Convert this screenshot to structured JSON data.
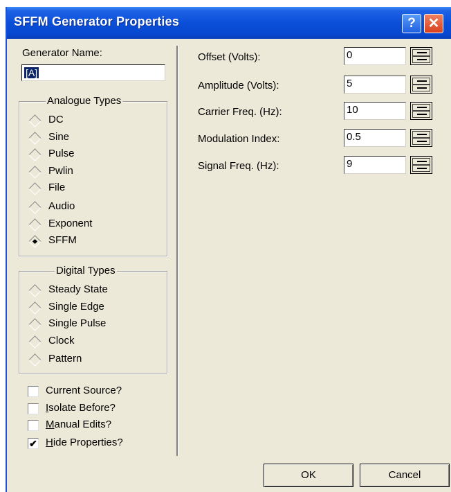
{
  "window": {
    "title": "SFFM Generator Properties",
    "help_glyph": "?",
    "close_glyph": "✕"
  },
  "generator": {
    "label": "Generator Name:",
    "value": "[A]"
  },
  "analogue": {
    "title": "Analogue Types",
    "options": [
      "DC",
      "Sine",
      "Pulse",
      "Pwlin",
      "File",
      "Audio",
      "Exponent",
      "SFFM"
    ],
    "selected": "SFFM"
  },
  "digital": {
    "title": "Digital Types",
    "options": [
      "Steady State",
      "Single Edge",
      "Single Pulse",
      "Clock",
      "Pattern"
    ]
  },
  "checkboxes": [
    {
      "label": "Current Source?",
      "checked": false
    },
    {
      "label": "Isolate Before?",
      "checked": false
    },
    {
      "label": "Manual Edits?",
      "checked": false
    },
    {
      "label": "Hide Properties?",
      "checked": true
    }
  ],
  "fields": [
    {
      "label": "Offset (Volts):",
      "value": "0"
    },
    {
      "label": "Amplitude (Volts):",
      "value": "5"
    },
    {
      "label": "Carrier Freq. (Hz):",
      "value": "10"
    },
    {
      "label": "Modulation Index:",
      "value": "0.5"
    },
    {
      "label": "Signal Freq. (Hz):",
      "value": "9"
    }
  ],
  "buttons": {
    "ok": "OK",
    "cancel": "Cancel"
  }
}
